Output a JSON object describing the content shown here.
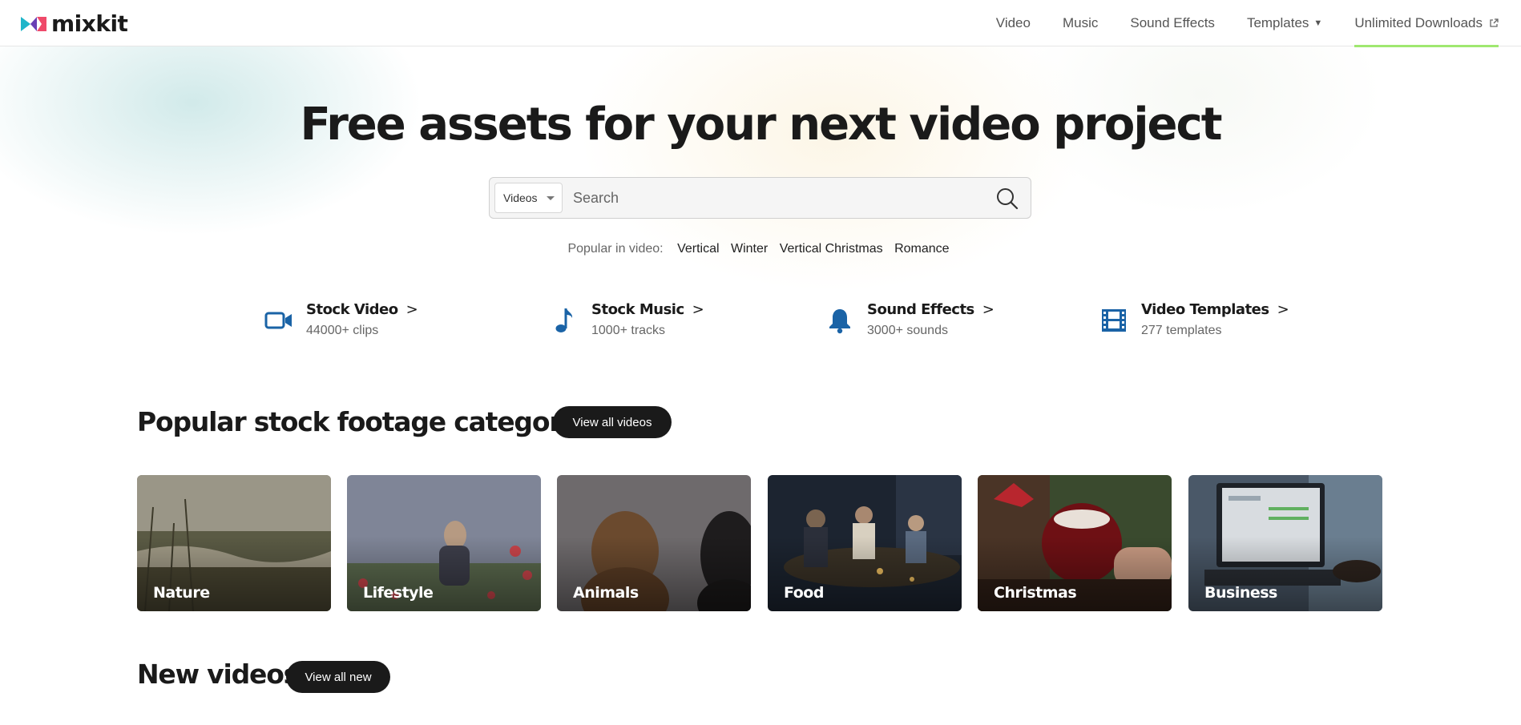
{
  "logo": {
    "text": "mixkit"
  },
  "nav": {
    "items": [
      {
        "label": "Video"
      },
      {
        "label": "Music"
      },
      {
        "label": "Sound Effects"
      },
      {
        "label": "Templates"
      },
      {
        "label": "Unlimited Downloads"
      }
    ]
  },
  "hero": {
    "title": "Free assets for your next video project",
    "search": {
      "category": "Videos",
      "placeholder": "Search"
    },
    "popular": {
      "label": "Popular in video:",
      "tags": [
        "Vertical",
        "Winter",
        "Vertical Christmas",
        "Romance"
      ]
    }
  },
  "categories": [
    {
      "title": "Stock Video",
      "subtitle": "44000+ clips",
      "icon": "video-camera-icon"
    },
    {
      "title": "Stock Music",
      "subtitle": "1000+ tracks",
      "icon": "music-note-icon"
    },
    {
      "title": "Sound Effects",
      "subtitle": "3000+ sounds",
      "icon": "bell-icon"
    },
    {
      "title": "Video Templates",
      "subtitle": "277 templates",
      "icon": "film-strip-icon"
    }
  ],
  "footage": {
    "title": "Popular stock footage categories",
    "button": "View all videos",
    "cards": [
      {
        "label": "Nature"
      },
      {
        "label": "Lifestyle"
      },
      {
        "label": "Animals"
      },
      {
        "label": "Food"
      },
      {
        "label": "Christmas"
      },
      {
        "label": "Business"
      }
    ]
  },
  "new_videos": {
    "title": "New videos",
    "button": "View all new"
  },
  "colors": {
    "accent": "#9fe870",
    "icon_blue": "#1a63a6",
    "dark": "#1a1a1a"
  }
}
